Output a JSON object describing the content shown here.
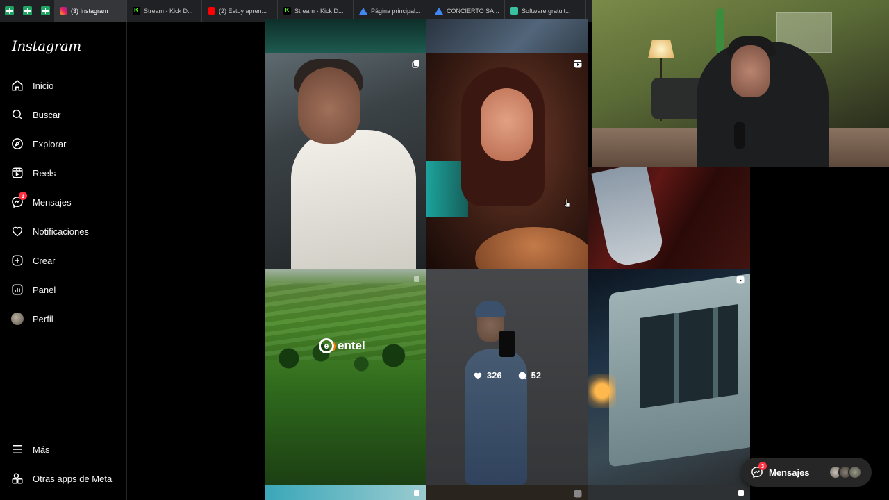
{
  "browser": {
    "tabs": [
      {
        "label": "(3) Instagram",
        "icon": "instagram-icon",
        "active": true
      },
      {
        "label": "Stream - Kick D...",
        "icon": "kick-icon"
      },
      {
        "label": "(2) Estoy apren...",
        "icon": "youtube-icon"
      },
      {
        "label": "Stream - Kick D...",
        "icon": "kick-icon"
      },
      {
        "label": "Página principal...",
        "icon": "drive-icon"
      },
      {
        "label": "CONCIERTO SA...",
        "icon": "drive-icon"
      },
      {
        "label": "Software gratuit...",
        "icon": "software-icon"
      }
    ]
  },
  "sidebar": {
    "logo": "Instagram",
    "items": [
      {
        "label": "Inicio",
        "icon": "home-icon"
      },
      {
        "label": "Buscar",
        "icon": "search-icon"
      },
      {
        "label": "Explorar",
        "icon": "compass-icon"
      },
      {
        "label": "Reels",
        "icon": "reels-icon"
      },
      {
        "label": "Mensajes",
        "icon": "messenger-icon",
        "badge": "3"
      },
      {
        "label": "Notificaciones",
        "icon": "heart-icon"
      },
      {
        "label": "Crear",
        "icon": "plus-square-icon"
      },
      {
        "label": "Panel",
        "icon": "dashboard-icon"
      },
      {
        "label": "Perfil",
        "icon": "avatar"
      }
    ],
    "bottom": [
      {
        "label": "Más",
        "icon": "menu-icon"
      },
      {
        "label": "Otras apps de Meta",
        "icon": "meta-apps-icon"
      }
    ]
  },
  "grid": {
    "hover_post": {
      "likes": "326",
      "comments": "52"
    },
    "ad_brand": "entel"
  },
  "messages_pill": {
    "label": "Mensajes",
    "badge": "3"
  },
  "colors": {
    "background": "#000000",
    "badge": "#ff3040",
    "pill": "#262626"
  }
}
